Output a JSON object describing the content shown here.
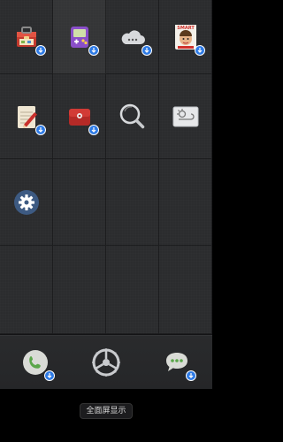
{
  "screen": {
    "type": "launcher-home-screen"
  },
  "apps": [
    {
      "id": "toolbox",
      "icon": "red-toolbox-icon",
      "download_badge": true
    },
    {
      "id": "game",
      "icon": "purple-gameboy-icon",
      "download_badge": true,
      "highlighted": true
    },
    {
      "id": "cloud",
      "icon": "cloud-icon",
      "download_badge": true
    },
    {
      "id": "smart",
      "icon": "smart-face-card-icon",
      "download_badge": true,
      "label_on_icon": "SMART"
    },
    {
      "id": "notepad",
      "icon": "notepad-pencil-icon",
      "download_badge": true
    },
    {
      "id": "red-case",
      "icon": "red-case-icon",
      "download_badge": true
    },
    {
      "id": "search",
      "icon": "magnifier-icon",
      "download_badge": false
    },
    {
      "id": "weather",
      "icon": "weather-widget-icon",
      "download_badge": false
    },
    {
      "id": "settings",
      "icon": "gear-icon",
      "download_badge": false
    }
  ],
  "dock": [
    {
      "id": "phone",
      "icon": "phone-icon",
      "download_badge": true
    },
    {
      "id": "launcher-settings",
      "icon": "steering-wheel-icon",
      "download_badge": false
    },
    {
      "id": "messages",
      "icon": "chat-bubble-icon",
      "download_badge": true
    }
  ],
  "bottom_bar": {
    "fullscreen_label": "全面屏显示"
  },
  "colors": {
    "background": "#2b2c2e",
    "badge": "#2e7be6",
    "settings_circle": "#3d5a82"
  }
}
